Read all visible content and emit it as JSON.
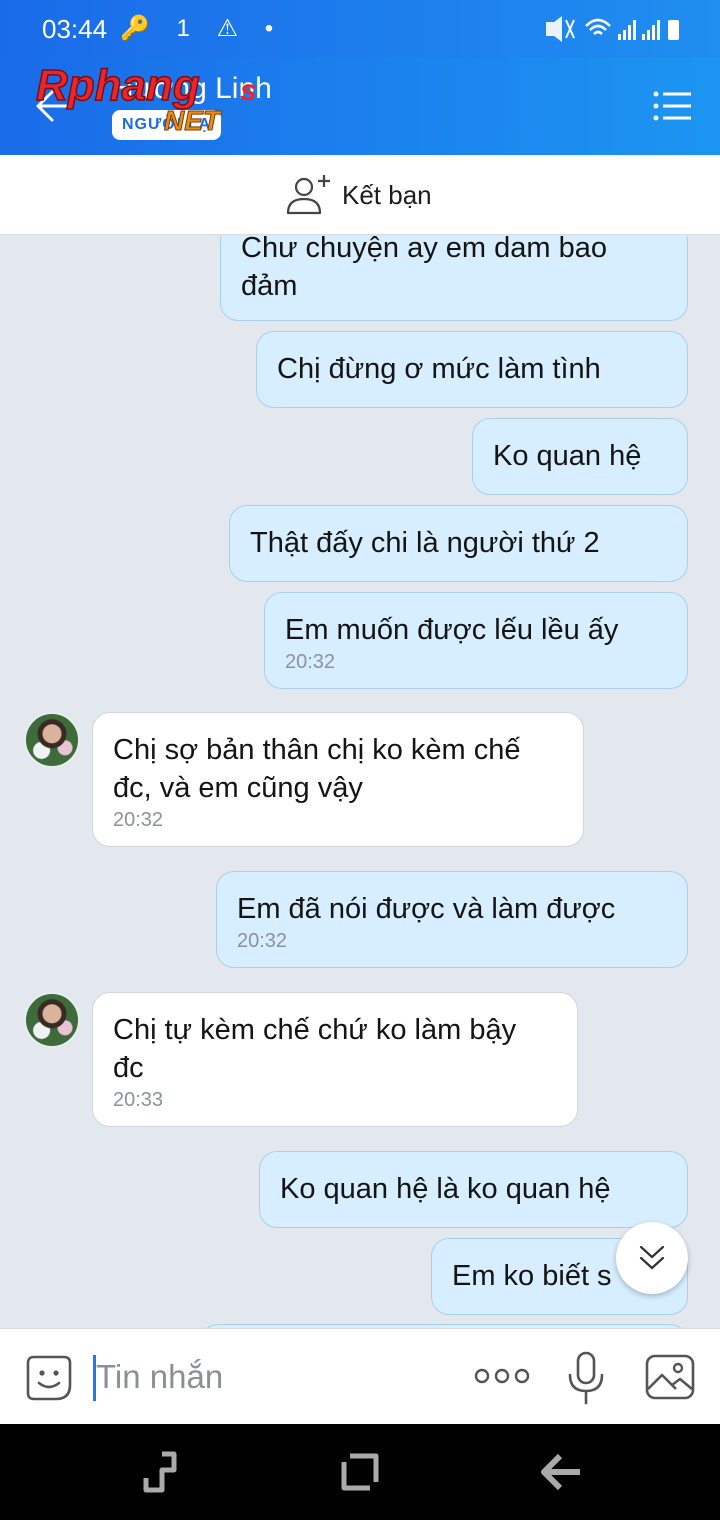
{
  "status_bar": {
    "time": "03:44",
    "left_icons": "🔑 1 ⚠ •",
    "right_icons": "🔇 📶"
  },
  "header": {
    "contact_name": "Hương Linh",
    "badge": "NGƯỜI LẠ",
    "watermark": "Rphang",
    "watermark_sub": "NET",
    "back_icon": "back-arrow-icon",
    "menu_icon": "list-menu-icon"
  },
  "friend_bar": {
    "label": "Kết bạn",
    "icon": "add-person-icon"
  },
  "messages": [
    {
      "dir": "out",
      "text": "Chư chuyện  ay  em dam bao",
      "text2": "đảm",
      "time": ""
    },
    {
      "dir": "out",
      "text": "Chị  đừng ơ  mức  làm  tình",
      "time": ""
    },
    {
      "dir": "out",
      "text": "Ko quan  hệ",
      "time": ""
    },
    {
      "dir": "out",
      "text": "Thật  đấy  chi là người  thứ  2",
      "time": ""
    },
    {
      "dir": "out",
      "text": "Em muốn  được  lếu lều ấy",
      "time": "20:32"
    },
    {
      "dir": "in",
      "text": "Chị sợ bản thân chị ko kèm chế",
      "text2": "đc, và em cũng vậy",
      "time": "20:32"
    },
    {
      "dir": "out",
      "text": "Em đã  nói được và làm  được",
      "time": "20:32"
    },
    {
      "dir": "in",
      "text": "Chị tự kèm chế chứ ko làm bậy",
      "text2": "đc",
      "time": "20:33"
    },
    {
      "dir": "out",
      "text": "Ko quan  hệ  là ko quan  hệ",
      "time": ""
    },
    {
      "dir": "out",
      "text": "Em ko biết  s",
      "time": ""
    }
  ],
  "input_bar": {
    "placeholder": "Tin nhắn",
    "sticker_icon": "emoji-sticker-icon",
    "more_icon": "more-dots-icon",
    "mic_icon": "microphone-icon",
    "image_icon": "image-icon"
  },
  "nav_bar": {
    "recent_icon": "recent-apps-icon",
    "home_icon": "home-icon",
    "back_icon": "back-icon"
  },
  "colors": {
    "header_blue": "#1a6be8",
    "outgoing_bubble": "#d6eeff",
    "incoming_bubble": "#ffffff",
    "chat_background": "#e3e8ef"
  }
}
